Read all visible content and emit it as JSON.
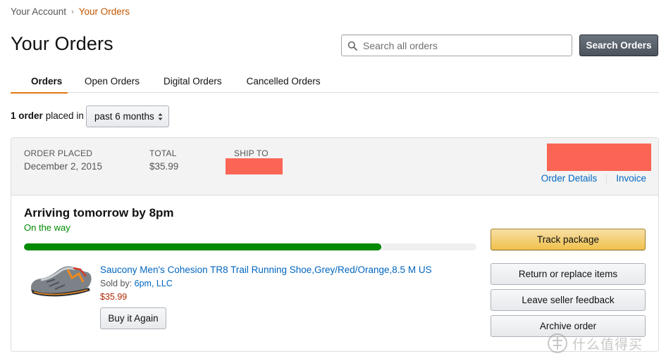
{
  "breadcrumb": {
    "parent": "Your Account",
    "separator": "›",
    "current": "Your Orders"
  },
  "page": {
    "title": "Your Orders"
  },
  "search": {
    "placeholder": "Search all orders",
    "button_label": "Search Orders"
  },
  "tabs": [
    {
      "label": "Orders",
      "active": true
    },
    {
      "label": "Open Orders",
      "active": false
    },
    {
      "label": "Digital Orders",
      "active": false
    },
    {
      "label": "Cancelled Orders",
      "active": false
    }
  ],
  "filter": {
    "count_text": "1 order",
    "suffix": "placed in",
    "selected": "past 6 months"
  },
  "order": {
    "placed_label": "ORDER PLACED",
    "placed_value": "December 2, 2015",
    "total_label": "TOTAL",
    "total_value": "$35.99",
    "ship_to_label": "SHIP TO",
    "details_link": "Order Details",
    "invoice_link": "Invoice",
    "status_title": "Arriving tomorrow by 8pm",
    "status_sub": "On the way",
    "progress_fraction": 0.79,
    "item": {
      "title": "Saucony Men's Cohesion TR8 Trail Running Shoe,Grey/Red/Orange,8.5 M US",
      "sold_by_label": "Sold by:",
      "seller": "6pm, LLC",
      "price": "$35.99",
      "buy_again": "Buy it Again"
    },
    "actions": {
      "track": "Track package",
      "return": "Return or replace items",
      "feedback": "Leave seller feedback",
      "archive": "Archive order"
    }
  },
  "watermark": {
    "text": "什么值得买",
    "icon": "zhi-icon"
  },
  "colors": {
    "accent_orange": "#e47911",
    "link_blue": "#0066c0",
    "status_green": "#008a00",
    "price_red": "#b12704",
    "redaction": "#fa6555",
    "primary_button": "#f0c14b"
  }
}
